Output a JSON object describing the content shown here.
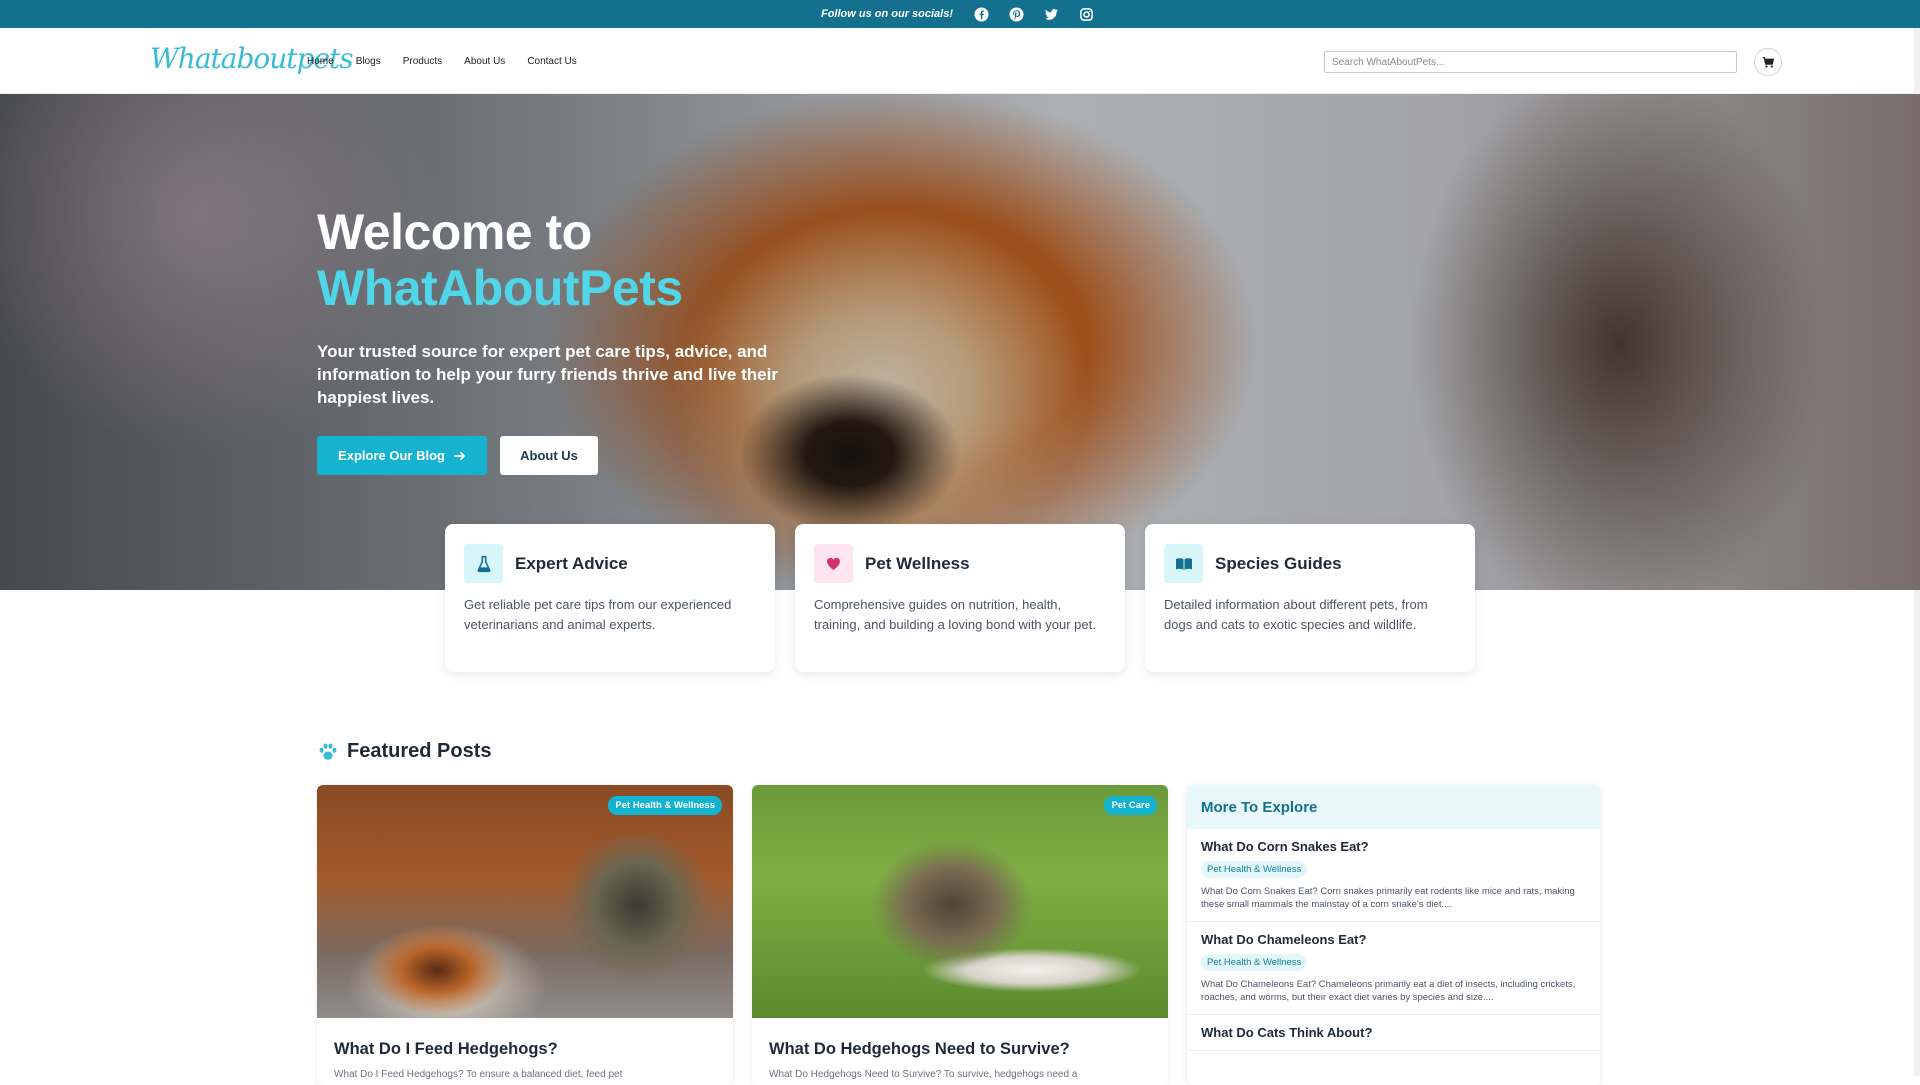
{
  "topbar": {
    "follow_text": "Follow us on our socials!",
    "socials": [
      "facebook-icon",
      "pinterest-icon",
      "twitter-icon",
      "instagram-icon"
    ]
  },
  "header": {
    "logo": "Whataboutpets",
    "nav": [
      "Home",
      "Blogs",
      "Products",
      "About Us",
      "Contact Us"
    ],
    "search_placeholder": "Search WhatAboutPets..."
  },
  "hero": {
    "title_line1": "Welcome to",
    "title_line2": "WhatAboutPets",
    "subtitle": "Your trusted source for expert pet care tips, advice, and information to help your furry friends thrive and live their happiest lives.",
    "primary_button": "Explore Our Blog",
    "secondary_button": "About Us"
  },
  "features": [
    {
      "icon": "flask-icon",
      "title": "Expert Advice",
      "description": "Get reliable pet care tips from our experienced veterinarians and animal experts."
    },
    {
      "icon": "heart-icon",
      "title": "Pet Wellness",
      "description": "Comprehensive guides on nutrition, health, training, and building a loving bond with your pet."
    },
    {
      "icon": "book-icon",
      "title": "Species Guides",
      "description": "Detailed information about different pets, from dogs and cats to exotic species and wildlife."
    }
  ],
  "featured": {
    "heading": "Featured Posts",
    "posts": [
      {
        "tag": "Pet Health & Wellness",
        "title": "What Do I Feed Hedgehogs?",
        "excerpt": "What Do I Feed Hedgehogs? To ensure a balanced diet, feed pet"
      },
      {
        "tag": "Pet Care",
        "title": "What Do Hedgehogs Need to Survive?",
        "excerpt": "What Do Hedgehogs Need to Survive? To survive, hedgehogs need a"
      }
    ]
  },
  "explore": {
    "heading": "More To Explore",
    "items": [
      {
        "title": "What Do Corn Snakes Eat?",
        "tag": "Pet Health & Wellness",
        "description": "What Do Corn Snakes Eat? Corn snakes primarily eat rodents like mice and rats, making these small mammals the mainstay of a corn snake's diet...."
      },
      {
        "title": "What Do Chameleons Eat?",
        "tag": "Pet Health & Wellness",
        "description": "What Do Chameleons Eat? Chameleons primarily eat a diet of insects, including crickets, roaches, and worms, but their exact diet varies by species and size...."
      },
      {
        "title": "What Do Cats Think About?",
        "tag": "",
        "description": ""
      }
    ]
  },
  "colors": {
    "brand": "#14708f",
    "accent": "#15b3cf",
    "highlight": "#4fd6e8"
  }
}
